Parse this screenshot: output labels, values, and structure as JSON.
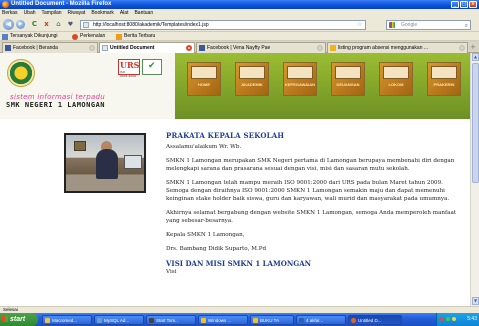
{
  "window": {
    "title": "Untitled Document - Mozilla Firefox",
    "controls": [
      "_",
      "□",
      "x"
    ]
  },
  "menubar": [
    "Berkas",
    "Ubah",
    "Tampilan",
    "Riwayat",
    "Bookmark",
    "Alat",
    "Bantuan"
  ],
  "nav": {
    "back": "◀",
    "forward": "▶",
    "reload": "C",
    "stop": "x",
    "home": "⌂",
    "url": "http://localhost:8080/akademik/Templates/index1.jsp",
    "search_placeholder": "Google"
  },
  "bookmarks": [
    "Tersanyak Dikunjungi",
    "Perkenalan",
    "Berita Terbaru"
  ],
  "tabs": [
    {
      "label": "Facebook | Beranda",
      "active": false
    },
    {
      "label": "Untitled Document",
      "active": true
    },
    {
      "label": "Facebook | Vena Nayfty Pae",
      "active": false
    },
    {
      "label": "listing program absensi menggunakan ...",
      "active": false
    }
  ],
  "header": {
    "urs_logo": "URS",
    "urs_sub": "ISO 9001:2000",
    "site_title": "sistem informasi terpadu",
    "school_name": "SMK NEGERI 1 LAMONGAN",
    "menu": [
      "HOME",
      "AKADEMIK",
      "KEPEGAWAIAN",
      "KEUANGAN",
      "LOKOM",
      "PRAKERIN"
    ]
  },
  "article": {
    "heading": "PRAKATA KEPALA SEKOLAH",
    "greeting": "Assalamu'alaikum Wr. Wb.",
    "paragraphs": [
      "SMKN 1 Lamongan merupakan SMK Negeri pertama di Lamongan berupaya membenahi diri dengan melengkapi sarana dan prasarana sesuai dengan visi, misi dan sasaran mutu sekolah.",
      "SMKN 1 Lamongan telah mampu meraih ISO 9001:2000 dari URS pada bulan Maret tahun 2009. Semoga dengan diraihnya ISO 9001:2000 SMKN 1 Lamongan semakin maju dan dapat memenuhi keinginan stake holder baik siswa, guru dan karyawan, wali murid dan masyarakat pada umumnya.",
      "Akhirnya selamat bergabung dengan website SMKN 1 Lamongan, semoga Anda memperoleh manfaat yang sebesar-besarnya."
    ],
    "closing": "Kepala SMKN 1 Lamongan,",
    "signature": "Drs. Bambang Didik Suparto, M.Pd",
    "section2": "VISI DAN MISI SMKN 1 LAMONGAN",
    "section2_first": "Visi"
  },
  "status": "Selesai",
  "taskbar": {
    "start": "start",
    "tasks": [
      "Macromed...",
      "MySQL Ad...",
      "Start Tom...",
      "Windows ...",
      "BUKU TA",
      "4 akhir...",
      "Untitled D..."
    ],
    "clock": "5:43"
  },
  "colors": {
    "titlebar": "#0a52d8",
    "header_green": "#7fa22a",
    "heading_blue": "#1e3e91",
    "site_title_pink": "#e83c8a",
    "taskbar_blue": "#245edb",
    "start_green": "#2f8a2f"
  }
}
